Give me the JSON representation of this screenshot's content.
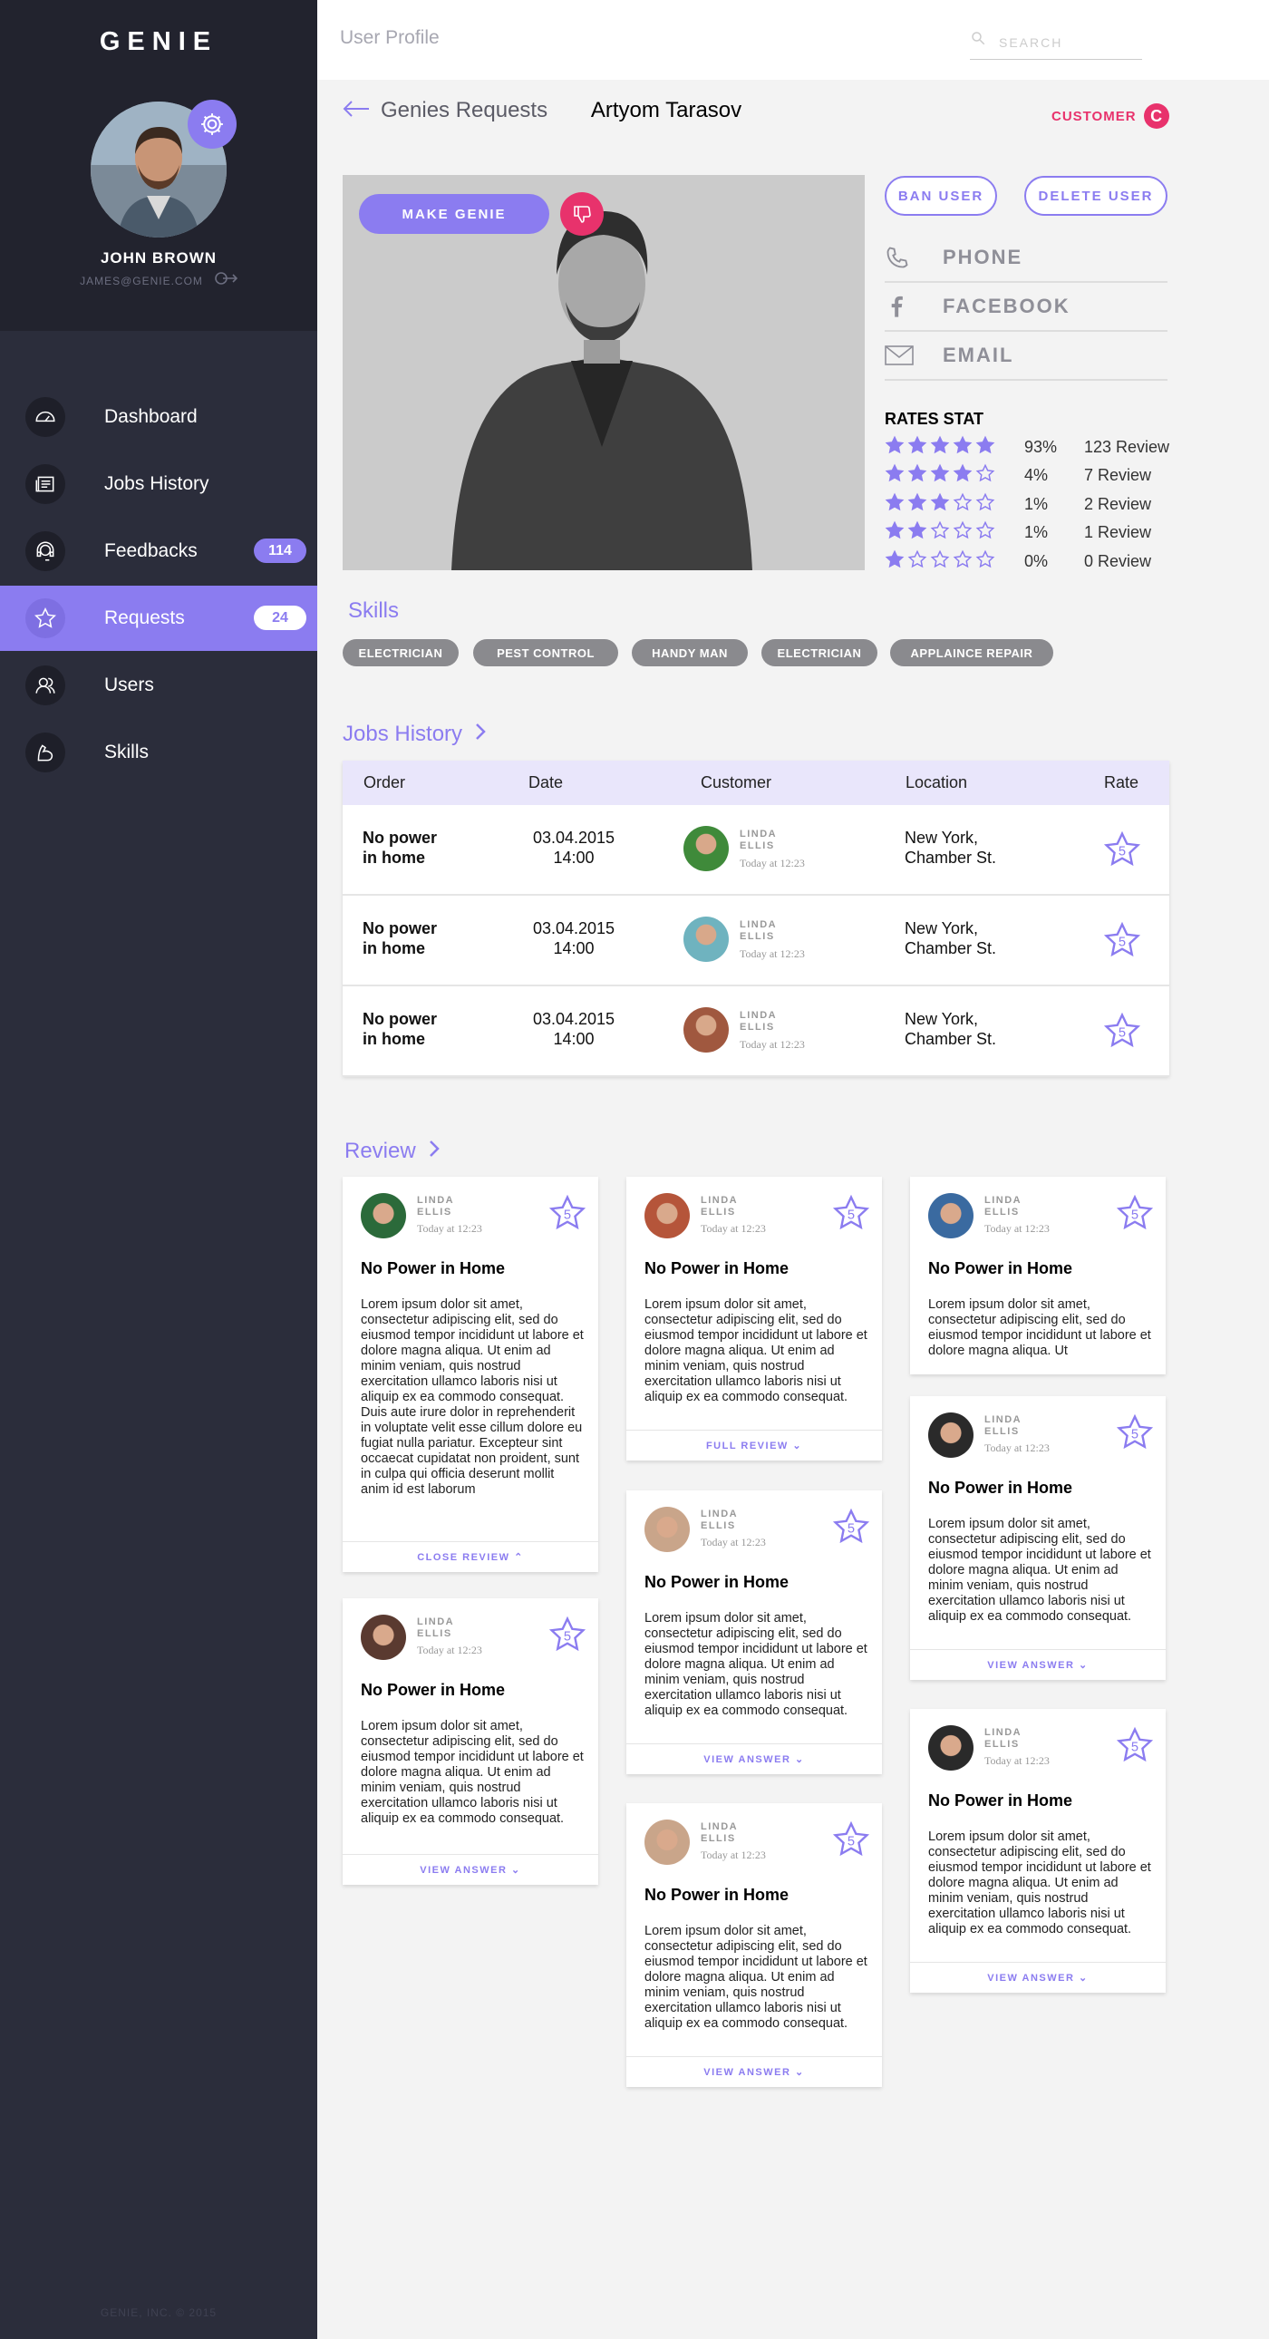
{
  "sidebar": {
    "logo": "GENIE",
    "user_name": "JOHN BROWN",
    "user_email": "JAMES@GENIE.COM",
    "nav": [
      {
        "label": "Dashboard",
        "icon": "speedometer-icon"
      },
      {
        "label": "Jobs History",
        "icon": "newspaper-icon"
      },
      {
        "label": "Feedbacks",
        "icon": "headset-icon",
        "badge": "114"
      },
      {
        "label": "Requests",
        "icon": "star-icon",
        "badge": "24",
        "active": true
      },
      {
        "label": "Users",
        "icon": "users-icon"
      },
      {
        "label": "Skills",
        "icon": "arm-icon"
      }
    ],
    "copyright": "GENIE, INC. © 2015"
  },
  "header": {
    "title": "User Profile",
    "search_placeholder": "SEARCH"
  },
  "profile": {
    "back_label": "Genies Requests",
    "name": "Artyom Tarasov",
    "role": "CUSTOMER",
    "role_badge": "C",
    "make_genie": "MAKE GENIE",
    "ban_user": "BAN USER",
    "delete_user": "DELETE USER",
    "contacts": [
      "PHONE",
      "FACEBOOK",
      "EMAIL"
    ],
    "rates_title": "RATES STAT",
    "rates": [
      {
        "stars": 5,
        "pct": "93%",
        "count": "123 Review"
      },
      {
        "stars": 4,
        "pct": "4%",
        "count": "7 Review"
      },
      {
        "stars": 3,
        "pct": "1%",
        "count": "2 Review"
      },
      {
        "stars": 2,
        "pct": "1%",
        "count": "1 Review"
      },
      {
        "stars": 1,
        "pct": "0%",
        "count": "0 Review"
      }
    ]
  },
  "skills": {
    "title": "Skills",
    "tags": [
      "ELECTRICIAN",
      "PEST CONTROL",
      "HANDY MAN",
      "ELECTRICIAN",
      "APPLAINCE REPAIR"
    ]
  },
  "jobs": {
    "title": "Jobs History",
    "columns": [
      "Order",
      "Date",
      "Customer",
      "Location",
      "Rate"
    ],
    "rows": [
      {
        "order1": "No power",
        "order2": "in home",
        "date": "03.04.2015",
        "time": "14:00",
        "name1": "LINDA",
        "name2": "ELLIS",
        "when": "Today at 12:23",
        "loc1": "New York,",
        "loc2": "Chamber St.",
        "rate": "5"
      },
      {
        "order1": "No power",
        "order2": "in home",
        "date": "03.04.2015",
        "time": "14:00",
        "name1": "LINDA",
        "name2": "ELLIS",
        "when": "Today at 12:23",
        "loc1": "New York,",
        "loc2": "Chamber St.",
        "rate": "5"
      },
      {
        "order1": "No power",
        "order2": "in home",
        "date": "03.04.2015",
        "time": "14:00",
        "name1": "LINDA",
        "name2": "ELLIS",
        "when": "Today at 12:23",
        "loc1": "New York,",
        "loc2": "Chamber St.",
        "rate": "5"
      }
    ]
  },
  "reviews": {
    "title": "Review",
    "cards": [
      {
        "name1": "LINDA",
        "name2": "ELLIS",
        "when": "Today at 12:23",
        "rate": "5",
        "title": "No Power in Home",
        "body": "Lorem ipsum dolor sit amet, consectetur adipiscing elit, sed do eiusmod tempor incididunt ut labore et dolore magna aliqua. Ut enim ad minim veniam, quis nostrud exercitation ullamco laboris nisi ut aliquip ex ea commodo consequat. Duis aute irure dolor in reprehenderit in voluptate velit esse cillum dolore eu fugiat nulla pariatur. Excepteur sint occaecat cupidatat non proident, sunt in culpa qui officia deserunt mollit anim id est laborum",
        "footer": "CLOSE REVIEW ⌃"
      },
      {
        "name1": "LINDA",
        "name2": "ELLIS",
        "when": "Today at 12:23",
        "rate": "5",
        "title": "No Power in Home",
        "body": "Lorem ipsum dolor sit amet, consectetur adipiscing elit, sed do eiusmod tempor incididunt ut labore et dolore magna aliqua. Ut enim ad minim veniam, quis nostrud exercitation ullamco laboris nisi ut aliquip ex ea commodo consequat.",
        "footer": "VIEW ANSWER ⌄"
      },
      {
        "name1": "LINDA",
        "name2": "ELLIS",
        "when": "Today at 12:23",
        "rate": "5",
        "title": "No Power in Home",
        "body": "Lorem ipsum dolor sit amet, consectetur adipiscing elit, sed do eiusmod tempor incididunt ut labore et dolore magna aliqua. Ut enim ad minim veniam, quis nostrud exercitation ullamco laboris nisi ut aliquip ex ea commodo consequat.",
        "footer": "FULL REVIEW ⌄"
      },
      {
        "name1": "LINDA",
        "name2": "ELLIS",
        "when": "Today at 12:23",
        "rate": "5",
        "title": "No Power in Home",
        "body": "Lorem ipsum dolor sit amet, consectetur adipiscing elit, sed do eiusmod tempor incididunt ut labore et dolore magna aliqua. Ut enim ad minim veniam, quis nostrud exercitation ullamco laboris nisi ut aliquip ex ea commodo consequat.",
        "footer": "VIEW ANSWER ⌄"
      },
      {
        "name1": "LINDA",
        "name2": "ELLIS",
        "when": "Today at 12:23",
        "rate": "5",
        "title": "No Power in Home",
        "body": "Lorem ipsum dolor sit amet, consectetur adipiscing elit, sed do eiusmod tempor incididunt ut labore et dolore magna aliqua. Ut enim ad minim veniam, quis nostrud exercitation ullamco laboris nisi ut aliquip ex ea commodo consequat.",
        "footer": "VIEW ANSWER ⌄"
      },
      {
        "name1": "LINDA",
        "name2": "ELLIS",
        "when": "Today at 12:23",
        "rate": "5",
        "title": "No Power in Home",
        "body": "Lorem ipsum dolor sit amet, consectetur adipiscing elit, sed do eiusmod tempor incididunt ut labore et dolore magna aliqua. Ut",
        "footer": ""
      },
      {
        "name1": "LINDA",
        "name2": "ELLIS",
        "when": "Today at 12:23",
        "rate": "5",
        "title": "No Power in Home",
        "body": "Lorem ipsum dolor sit amet, consectetur adipiscing elit, sed do eiusmod tempor incididunt ut labore et dolore magna aliqua. Ut enim ad minim veniam, quis nostrud exercitation ullamco laboris nisi ut aliquip ex ea commodo consequat.",
        "footer": "VIEW ANSWER ⌄"
      },
      {
        "name1": "LINDA",
        "name2": "ELLIS",
        "when": "Today at 12:23",
        "rate": "5",
        "title": "No Power in Home",
        "body": "Lorem ipsum dolor sit amet, consectetur adipiscing elit, sed do eiusmod tempor incididunt ut labore et dolore magna aliqua. Ut enim ad minim veniam, quis nostrud exercitation ullamco laboris nisi ut aliquip ex ea commodo consequat.",
        "footer": "VIEW ANSWER ⌄"
      }
    ]
  },
  "colors": {
    "accent": "#8b7cf0",
    "sidebar": "#2b2d3b",
    "danger": "#e8326c",
    "tag": "#8a8a8e"
  }
}
